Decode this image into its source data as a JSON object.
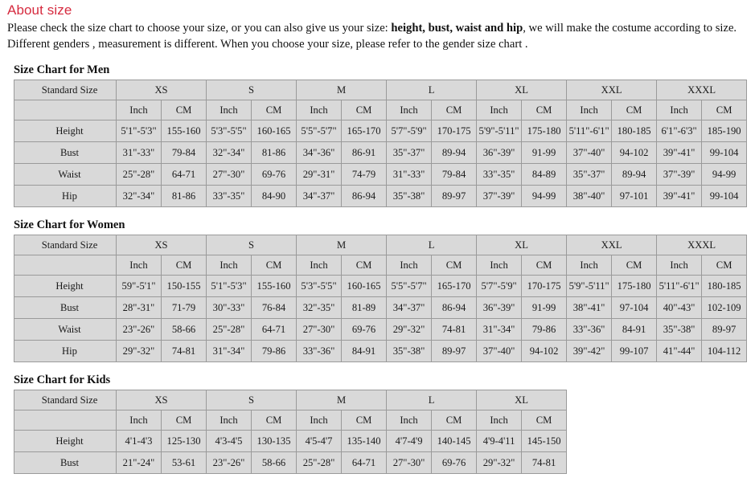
{
  "header": {
    "title": "About size",
    "title_color": "#d62b3f",
    "description_parts": [
      {
        "text": "Please check the size chart to choose your size, or you can also give us your size: ",
        "bold": false
      },
      {
        "text": "height, bust, waist and hip",
        "bold": true
      },
      {
        "text": ", we will make the costume according to size. Different genders , measurement  is different. When you choose your size, please refer to the gender size chart .",
        "bold": false
      }
    ]
  },
  "common": {
    "standard_size_label": "Standard Size",
    "unit_inch": "Inch",
    "unit_cm": "CM"
  },
  "charts": [
    {
      "title": "Size Chart for Men",
      "sizes": [
        "XS",
        "S",
        "M",
        "L",
        "XL",
        "XXL",
        "XXXL"
      ],
      "rows": [
        {
          "label": "Height",
          "values": [
            {
              "inch": "5'1\"-5'3\"",
              "cm": "155-160"
            },
            {
              "inch": "5'3\"-5'5\"",
              "cm": "160-165"
            },
            {
              "inch": "5'5\"-5'7\"",
              "cm": "165-170"
            },
            {
              "inch": "5'7\"-5'9\"",
              "cm": "170-175"
            },
            {
              "inch": "5'9\"-5'11\"",
              "cm": "175-180"
            },
            {
              "inch": "5'11\"-6'1\"",
              "cm": "180-185"
            },
            {
              "inch": "6'1\"-6'3\"",
              "cm": "185-190"
            }
          ]
        },
        {
          "label": "Bust",
          "values": [
            {
              "inch": "31\"-33\"",
              "cm": "79-84"
            },
            {
              "inch": "32\"-34\"",
              "cm": "81-86"
            },
            {
              "inch": "34\"-36\"",
              "cm": "86-91"
            },
            {
              "inch": "35\"-37\"",
              "cm": "89-94"
            },
            {
              "inch": "36\"-39\"",
              "cm": "91-99"
            },
            {
              "inch": "37\"-40\"",
              "cm": "94-102"
            },
            {
              "inch": "39\"-41\"",
              "cm": "99-104"
            }
          ]
        },
        {
          "label": "Waist",
          "values": [
            {
              "inch": "25\"-28\"",
              "cm": "64-71"
            },
            {
              "inch": "27\"-30\"",
              "cm": "69-76"
            },
            {
              "inch": "29\"-31\"",
              "cm": "74-79"
            },
            {
              "inch": "31\"-33\"",
              "cm": "79-84"
            },
            {
              "inch": "33\"-35\"",
              "cm": "84-89"
            },
            {
              "inch": "35\"-37\"",
              "cm": "89-94"
            },
            {
              "inch": "37\"-39\"",
              "cm": "94-99"
            }
          ]
        },
        {
          "label": "Hip",
          "values": [
            {
              "inch": "32\"-34\"",
              "cm": "81-86"
            },
            {
              "inch": "33\"-35\"",
              "cm": "84-90"
            },
            {
              "inch": "34\"-37\"",
              "cm": "86-94"
            },
            {
              "inch": "35\"-38\"",
              "cm": "89-97"
            },
            {
              "inch": "37\"-39\"",
              "cm": "94-99"
            },
            {
              "inch": "38\"-40\"",
              "cm": "97-101"
            },
            {
              "inch": "39\"-41\"",
              "cm": "99-104"
            }
          ]
        }
      ]
    },
    {
      "title": "Size Chart for Women",
      "sizes": [
        "XS",
        "S",
        "M",
        "L",
        "XL",
        "XXL",
        "XXXL"
      ],
      "rows": [
        {
          "label": "Height",
          "values": [
            {
              "inch": "59\"-5'1\"",
              "cm": "150-155"
            },
            {
              "inch": "5'1\"-5'3\"",
              "cm": "155-160"
            },
            {
              "inch": "5'3\"-5'5\"",
              "cm": "160-165"
            },
            {
              "inch": "5'5\"-5'7\"",
              "cm": "165-170"
            },
            {
              "inch": "5'7\"-5'9\"",
              "cm": "170-175"
            },
            {
              "inch": "5'9\"-5'11\"",
              "cm": "175-180"
            },
            {
              "inch": "5'11\"-6'1\"",
              "cm": "180-185"
            }
          ]
        },
        {
          "label": "Bust",
          "values": [
            {
              "inch": "28\"-31\"",
              "cm": "71-79"
            },
            {
              "inch": "30\"-33\"",
              "cm": "76-84"
            },
            {
              "inch": "32\"-35\"",
              "cm": "81-89"
            },
            {
              "inch": "34\"-37\"",
              "cm": "86-94"
            },
            {
              "inch": "36\"-39\"",
              "cm": "91-99"
            },
            {
              "inch": "38\"-41\"",
              "cm": "97-104"
            },
            {
              "inch": "40\"-43\"",
              "cm": "102-109"
            }
          ]
        },
        {
          "label": "Waist",
          "values": [
            {
              "inch": "23\"-26\"",
              "cm": "58-66"
            },
            {
              "inch": "25\"-28\"",
              "cm": "64-71"
            },
            {
              "inch": "27\"-30\"",
              "cm": "69-76"
            },
            {
              "inch": "29\"-32\"",
              "cm": "74-81"
            },
            {
              "inch": "31\"-34\"",
              "cm": "79-86"
            },
            {
              "inch": "33\"-36\"",
              "cm": "84-91"
            },
            {
              "inch": "35\"-38\"",
              "cm": "89-97"
            }
          ]
        },
        {
          "label": "Hip",
          "values": [
            {
              "inch": "29\"-32\"",
              "cm": "74-81"
            },
            {
              "inch": "31\"-34\"",
              "cm": "79-86"
            },
            {
              "inch": "33\"-36\"",
              "cm": "84-91"
            },
            {
              "inch": "35\"-38\"",
              "cm": "89-97"
            },
            {
              "inch": "37\"-40\"",
              "cm": "94-102"
            },
            {
              "inch": "39\"-42\"",
              "cm": "99-107"
            },
            {
              "inch": "41\"-44\"",
              "cm": "104-112"
            }
          ]
        }
      ]
    },
    {
      "title": "Size Chart for Kids",
      "sizes": [
        "XS",
        "S",
        "M",
        "L",
        "XL"
      ],
      "rows": [
        {
          "label": "Height",
          "values": [
            {
              "inch": "4'1-4'3",
              "cm": "125-130"
            },
            {
              "inch": "4'3-4'5",
              "cm": "130-135"
            },
            {
              "inch": "4'5-4'7",
              "cm": "135-140"
            },
            {
              "inch": "4'7-4'9",
              "cm": "140-145"
            },
            {
              "inch": "4'9-4'11",
              "cm": "145-150"
            }
          ]
        },
        {
          "label": "Bust",
          "values": [
            {
              "inch": "21\"-24\"",
              "cm": "53-61"
            },
            {
              "inch": "23\"-26\"",
              "cm": "58-66"
            },
            {
              "inch": "25\"-28\"",
              "cm": "64-71"
            },
            {
              "inch": "27\"-30\"",
              "cm": "69-76"
            },
            {
              "inch": "29\"-32\"",
              "cm": "74-81"
            }
          ]
        }
      ]
    }
  ]
}
